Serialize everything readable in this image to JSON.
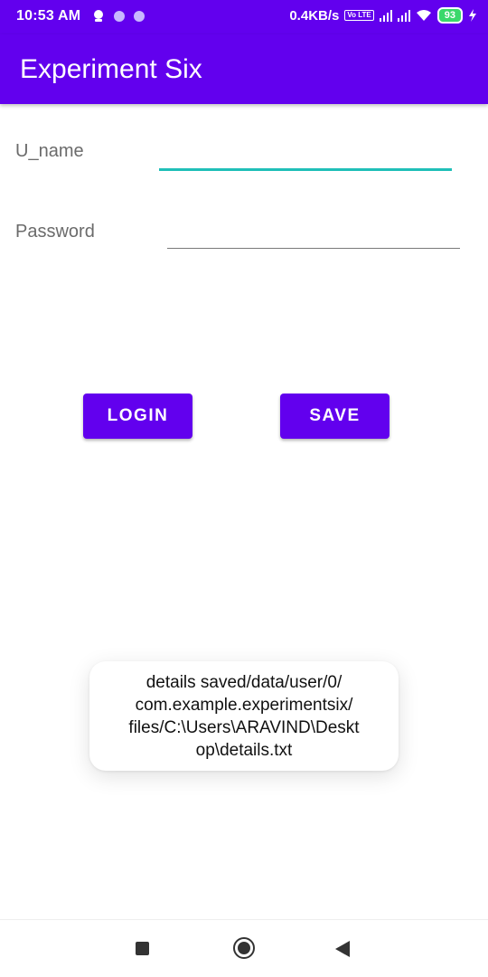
{
  "status_bar": {
    "time": "10:53 AM",
    "network_speed": "0.4KB/s",
    "volte": "Vo LTE",
    "battery_level": "93",
    "icons": [
      "notification-icon",
      "dot-icon",
      "dot-icon",
      "volte-icon",
      "signal-icon",
      "signal-icon",
      "wifi-icon",
      "battery-icon",
      "charging-icon"
    ]
  },
  "app_bar": {
    "title": "Experiment Six",
    "color": "#6200ee"
  },
  "form": {
    "username_label": "U_name",
    "username_value": "",
    "password_label": "Password",
    "password_value": "",
    "focused_underline_color": "#1fbfb8"
  },
  "buttons": {
    "login_label": "LOGIN",
    "save_label": "SAVE"
  },
  "toast": {
    "message": "details saved/data/user/0/\ncom.example.experimentsix/\nfiles/C:\\Users\\ARAVIND\\Deskt\nop\\details.txt"
  },
  "nav_bar": {
    "icons": [
      "recents-icon",
      "home-icon",
      "back-icon"
    ]
  }
}
